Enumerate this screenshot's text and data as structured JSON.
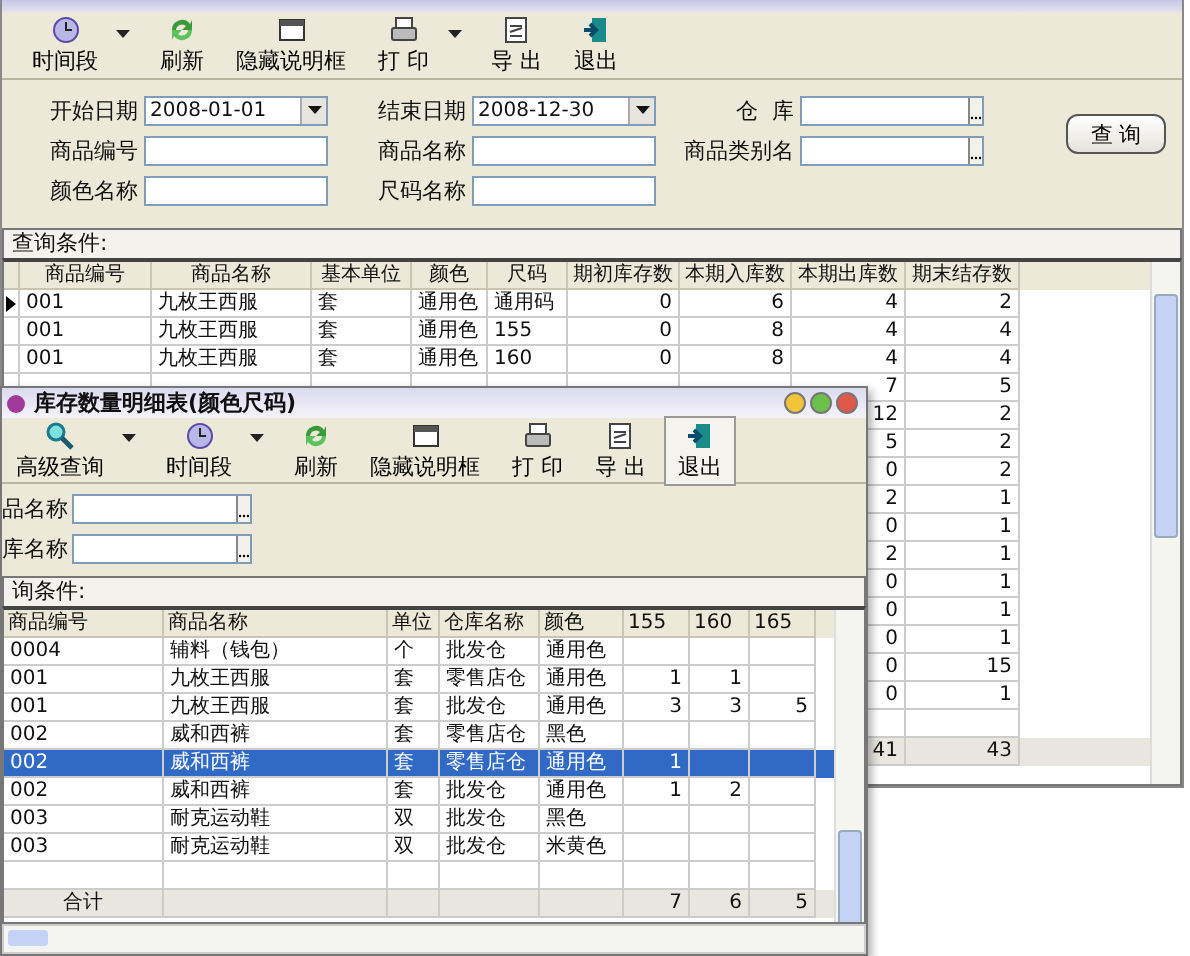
{
  "back_window": {
    "toolbar": [
      {
        "label": "时间段",
        "kind": "clock",
        "dropdown": true,
        "pressed": false
      },
      {
        "label": "刷新",
        "kind": "refresh",
        "dropdown": false,
        "pressed": false
      },
      {
        "label": "隐藏说明框",
        "kind": "panel",
        "dropdown": false,
        "pressed": false
      },
      {
        "label": "打 印",
        "kind": "printer",
        "dropdown": true,
        "pressed": false
      },
      {
        "label": "导 出",
        "kind": "export",
        "dropdown": false,
        "pressed": false
      },
      {
        "label": "退出",
        "kind": "exit",
        "dropdown": false,
        "pressed": false
      }
    ],
    "filters": [
      [
        {
          "label": "开始日期",
          "value": "2008-01-01",
          "kind": "date"
        },
        {
          "label": "结束日期",
          "value": "2008-12-30",
          "kind": "date"
        },
        {
          "label": "仓  库",
          "kind": "browse"
        }
      ],
      [
        {
          "label": "商品编号",
          "kind": "text"
        },
        {
          "label": "商品名称",
          "kind": "text"
        },
        {
          "label": "商品类别名",
          "kind": "browse"
        }
      ],
      [
        {
          "label": "颜色名称",
          "kind": "text"
        },
        {
          "label": "尺码名称",
          "kind": "text"
        }
      ]
    ],
    "query_button": "查 询",
    "conditions_label": "查询条件:",
    "table": {
      "columns": [
        "商品编号",
        "商品名称",
        "基本单位",
        "颜色",
        "尺码",
        "期初库存数",
        "本期入库数",
        "本期出库数",
        "期末结存数"
      ],
      "rows": [
        {
          "kind": "full",
          "current": true,
          "cells": [
            "001",
            "九枚王西服",
            "套",
            "通用色",
            "通用码",
            "0",
            "6",
            "4",
            "2"
          ]
        },
        {
          "kind": "full",
          "current": false,
          "cells": [
            "001",
            "九枚王西服",
            "套",
            "通用色",
            "155",
            "0",
            "8",
            "4",
            "4"
          ]
        },
        {
          "kind": "full",
          "current": false,
          "cells": [
            "001",
            "九枚王西服",
            "套",
            "通用色",
            "160",
            "0",
            "8",
            "4",
            "4"
          ]
        },
        {
          "kind": "covered",
          "cells": [
            "7",
            "5"
          ]
        },
        {
          "kind": "covered",
          "cells": [
            "12",
            "2"
          ]
        },
        {
          "kind": "covered",
          "cells": [
            "5",
            "2"
          ]
        },
        {
          "kind": "covered",
          "cells": [
            "0",
            "2"
          ]
        },
        {
          "kind": "covered",
          "cells": [
            "2",
            "1"
          ]
        },
        {
          "kind": "covered",
          "cells": [
            "0",
            "1"
          ]
        },
        {
          "kind": "covered",
          "cells": [
            "2",
            "1"
          ]
        },
        {
          "kind": "covered",
          "cells": [
            "0",
            "1"
          ]
        },
        {
          "kind": "covered",
          "cells": [
            "0",
            "1"
          ]
        },
        {
          "kind": "covered",
          "cells": [
            "0",
            "1"
          ]
        },
        {
          "kind": "covered",
          "cells": [
            "0",
            "15"
          ]
        },
        {
          "kind": "covered",
          "cells": [
            "0",
            "1"
          ]
        }
      ],
      "totals": [
        "41",
        "43"
      ]
    }
  },
  "front_window": {
    "title": "库存数量明细表(颜色尺码)",
    "toolbar": [
      {
        "label": "高级查询",
        "kind": "search",
        "dropdown": true,
        "pressed": false
      },
      {
        "label": "时间段",
        "kind": "clock",
        "dropdown": true,
        "pressed": false
      },
      {
        "label": "刷新",
        "kind": "refresh",
        "dropdown": false,
        "pressed": false
      },
      {
        "label": "隐藏说明框",
        "kind": "panel",
        "dropdown": false,
        "pressed": false
      },
      {
        "label": "打 印",
        "kind": "printer",
        "dropdown": false,
        "pressed": false
      },
      {
        "label": "导 出",
        "kind": "export",
        "dropdown": false,
        "pressed": false
      },
      {
        "label": "退出",
        "kind": "exit",
        "dropdown": false,
        "pressed": true
      }
    ],
    "fields": [
      {
        "label": "品名称",
        "kind": "browse"
      },
      {
        "label": "库名称",
        "kind": "browse"
      }
    ],
    "conditions_label": "询条件:",
    "table": {
      "columns": [
        "商品编号",
        "商品名称",
        "单位",
        "仓库名称",
        "颜色",
        "155",
        "160",
        "165"
      ],
      "rows": [
        {
          "selected": false,
          "cells": [
            "0004",
            "辅料（钱包）",
            "个",
            "批发仓",
            "通用色"
          ]
        },
        {
          "selected": false,
          "cells": [
            "001",
            "九枚王西服",
            "套",
            "零售店仓",
            "通用色",
            "1",
            "1"
          ]
        },
        {
          "selected": false,
          "cells": [
            "001",
            "九枚王西服",
            "套",
            "批发仓",
            "通用色",
            "3",
            "3",
            "5"
          ]
        },
        {
          "selected": false,
          "cells": [
            "002",
            "威和西裤",
            "套",
            "零售店仓",
            "黑色"
          ]
        },
        {
          "selected": true,
          "cells": [
            "002",
            "威和西裤",
            "套",
            "零售店仓",
            "通用色",
            "1"
          ]
        },
        {
          "selected": false,
          "cells": [
            "002",
            "威和西裤",
            "套",
            "批发仓",
            "通用色",
            "1",
            "2"
          ]
        },
        {
          "selected": false,
          "cells": [
            "003",
            "耐克运动鞋",
            "双",
            "批发仓",
            "黑色"
          ]
        },
        {
          "selected": false,
          "cells": [
            "003",
            "耐克运动鞋",
            "双",
            "批发仓",
            "米黄色"
          ]
        }
      ],
      "totals": {
        "label": "合计",
        "values": [
          "7",
          "6",
          "5"
        ]
      }
    }
  }
}
